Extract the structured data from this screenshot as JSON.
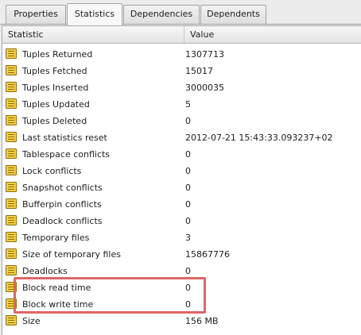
{
  "tabs": [
    {
      "label": "Properties"
    },
    {
      "label": "Statistics"
    },
    {
      "label": "Dependencies"
    },
    {
      "label": "Dependents"
    }
  ],
  "active_tab": "Statistics",
  "columns": {
    "statistic": "Statistic",
    "value": "Value"
  },
  "rows": [
    {
      "statistic": "Tuples Returned",
      "value": "1307713"
    },
    {
      "statistic": "Tuples Fetched",
      "value": "15017"
    },
    {
      "statistic": "Tuples Inserted",
      "value": "3000035"
    },
    {
      "statistic": "Tuples Updated",
      "value": "5"
    },
    {
      "statistic": "Tuples Deleted",
      "value": "0"
    },
    {
      "statistic": "Last statistics reset",
      "value": "2012-07-21 15:43:33.093237+02"
    },
    {
      "statistic": "Tablespace conflicts",
      "value": "0"
    },
    {
      "statistic": "Lock conflicts",
      "value": "0"
    },
    {
      "statistic": "Snapshot conflicts",
      "value": "0"
    },
    {
      "statistic": "Bufferpin conflicts",
      "value": "0"
    },
    {
      "statistic": "Deadlock conflicts",
      "value": "0"
    },
    {
      "statistic": "Temporary files",
      "value": "3"
    },
    {
      "statistic": "Size of temporary files",
      "value": "15867776"
    },
    {
      "statistic": "Deadlocks",
      "value": "0"
    },
    {
      "statistic": "Block read time",
      "value": "0"
    },
    {
      "statistic": "Block write time",
      "value": "0"
    },
    {
      "statistic": "Size",
      "value": "156 MB"
    }
  ],
  "row_icon": "statistic-list-icon",
  "colors": {
    "highlight_border": "#e06666",
    "icon_fill": "#f4d03f",
    "icon_lines": "#8a6d12"
  }
}
